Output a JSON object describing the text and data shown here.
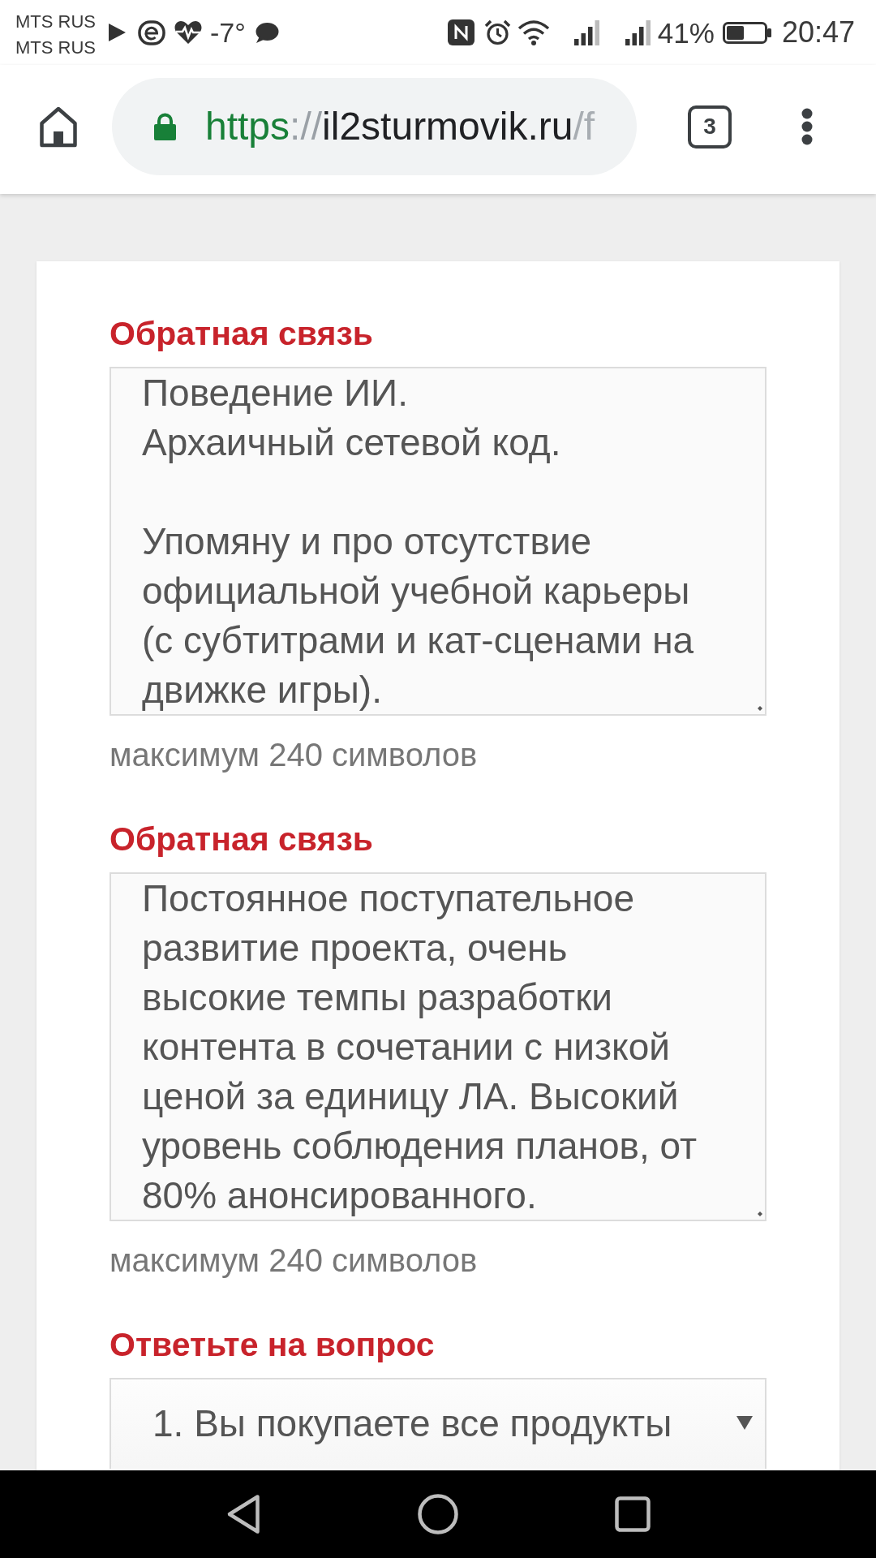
{
  "status_bar": {
    "carriers": [
      "MTS RUS",
      "MTS RUS"
    ],
    "temperature": "-7°",
    "battery_percent": "41%",
    "time": "20:47"
  },
  "browser_toolbar": {
    "url": {
      "scheme": "https",
      "separator": "://",
      "host": "il2sturmovik.ru",
      "path": "/f"
    },
    "tab_count": "3"
  },
  "form": {
    "fields": [
      {
        "kind": "textarea",
        "label": "Обратная связь",
        "value": "Поведение ИИ.\nАрхаичный сетевой код.\n\nУпомяну и про отсутствие\nофициальной учебной карьеры\n(с субтитрами и кат-сценами на\nдвижке игры).",
        "hint": "максимум 240 символов"
      },
      {
        "kind": "textarea",
        "label": "Обратная связь",
        "value": "Постоянное поступательное\nразвитие проекта, очень\nвысокие темпы разработки\nконтента в сочетании с низкой\nценой за единицу ЛА. Высокий\nуровень соблюдения планов, от\n80% анонсированного.",
        "hint": "максимум 240 символов"
      },
      {
        "kind": "select",
        "label": "Ответьте на вопрос",
        "value": "1. Вы покупаете все продукты"
      }
    ]
  }
}
